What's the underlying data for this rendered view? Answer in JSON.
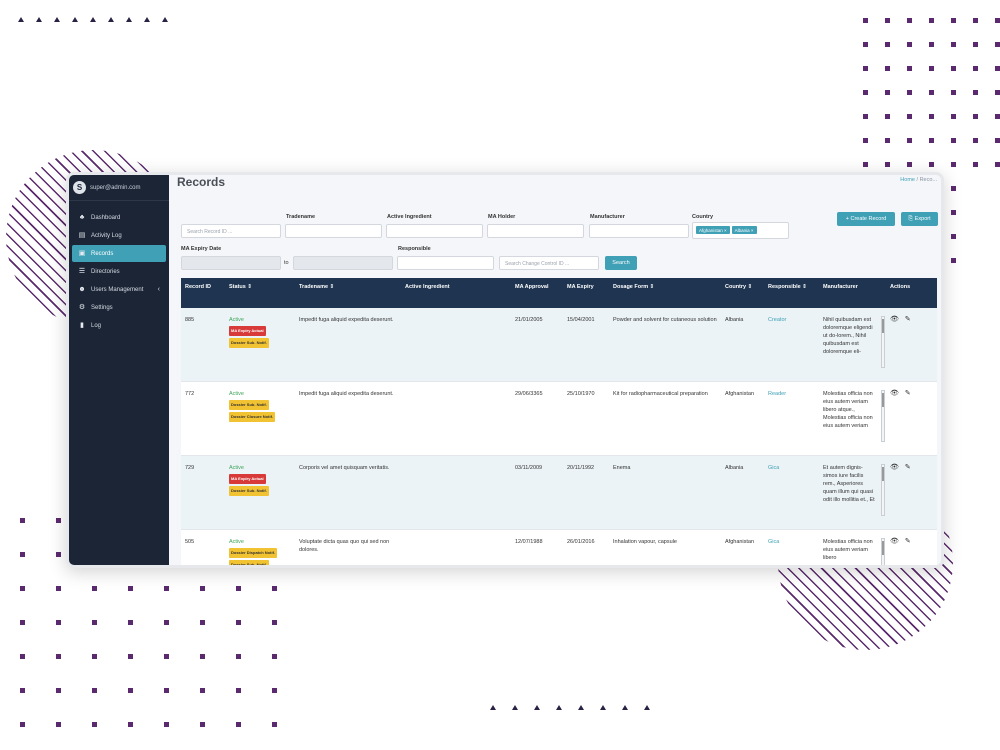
{
  "colors": {
    "accent": "#3fa0b6",
    "sidebar": "#1b2535",
    "table_header": "#1e3450",
    "status_active": "#3ea55a",
    "badge_red": "#d83a3a",
    "badge_yellow": "#f1c232",
    "decor_purple": "#5b2a6e"
  },
  "sidebar": {
    "avatar_letter": "S",
    "user_email": "super@admin.com",
    "items": [
      {
        "label": "Dashboard",
        "icon": "dashboard-icon",
        "glyph": "♣",
        "active": false
      },
      {
        "label": "Activity Log",
        "icon": "activity-log-icon",
        "glyph": "▤",
        "active": false
      },
      {
        "label": "Records",
        "icon": "records-icon",
        "glyph": "▣",
        "active": true
      },
      {
        "label": "Directories",
        "icon": "directories-icon",
        "glyph": "☰",
        "active": false
      },
      {
        "label": "Users Management",
        "icon": "users-icon",
        "glyph": "☻",
        "active": false,
        "caret": "‹"
      },
      {
        "label": "Settings",
        "icon": "settings-icon",
        "glyph": "⚙",
        "active": false
      },
      {
        "label": "Log",
        "icon": "log-icon",
        "glyph": "▮",
        "active": false
      }
    ]
  },
  "header": {
    "title": "Records",
    "breadcrumb_home": "Home",
    "breadcrumb_sep": " / ",
    "breadcrumb_current": "Reco..."
  },
  "filters": {
    "record_id_placeholder": "Search Record ID ...",
    "tradename_label": "Tradename",
    "active_ingredient_label": "Active Ingredient",
    "ma_holder_label": "MA Holder",
    "manufacturer_label": "Manufacturer",
    "country_label": "Country",
    "country_chips": [
      "Afghanistan ×",
      "Albania ×"
    ],
    "ma_expiry_label": "MA Expiry Date",
    "to_label": "to",
    "responsible_label": "Responsible",
    "change_control_placeholder": "Search Change Control ID ...",
    "search_button": "Search",
    "create_button": "+ Create Record",
    "export_button": "Export",
    "export_icon": "export-icon"
  },
  "table": {
    "headers": [
      "Record ID",
      "Status ⇕",
      "Tradename ⇕",
      "Active Ingredient",
      "MA Approval",
      "MA Expiry",
      "Dosage Form ⇕",
      "Country ⇕",
      "Responsible ⇕",
      "Manufacturer",
      "Actions"
    ],
    "sort_glyph": "⇕",
    "rows": [
      {
        "id": "885",
        "status": "Active",
        "badges": [
          {
            "text": "MA Expiry Actual",
            "color": "red"
          },
          {
            "text": "Dossier Sub. Notif.",
            "color": "yellow"
          }
        ],
        "tradename": "Impedit fuga aliquid expedita deserunt.",
        "active_ingredient": "",
        "ma_approval": "21/01/2005",
        "ma_expiry": "15/04/2001",
        "dosage_form": "Powder and solvent for cutaneous solution",
        "country": "Albania",
        "responsible": "Creator",
        "manufacturer": "Nihil quibusdam est doloremque eligendi ut do-lorem., Nihil quibusdam est doloremque eli-"
      },
      {
        "id": "772",
        "status": "Active",
        "badges": [
          {
            "text": "Dossier Sub. Notif.",
            "color": "yellow"
          },
          {
            "text": "Dossier Closure Notif.",
            "color": "yellow"
          }
        ],
        "tradename": "Impedit fuga aliquid expedita deserunt.",
        "active_ingredient": "",
        "ma_approval": "29/06/3365",
        "ma_expiry": "25/10/1970",
        "dosage_form": "Kit for radiopharmaceutical preparation",
        "country": "Afghanistan",
        "responsible": "Reader",
        "manufacturer": "Molestias officia non eius autem veriam libero atque., Molestias officia non eius autem veriam"
      },
      {
        "id": "729",
        "status": "Active",
        "badges": [
          {
            "text": "MA Expiry Actual",
            "color": "red"
          },
          {
            "text": "Dossier Sub. Notif.",
            "color": "yellow"
          }
        ],
        "tradename": "Corporis vel amet quisquam veritatis.",
        "active_ingredient": "",
        "ma_approval": "03/11/2009",
        "ma_expiry": "20/11/1992",
        "dosage_form": "Enema",
        "country": "Albania",
        "responsible": "Gica",
        "manufacturer": "Et autem dignis-simos iure facilis rem., Asperiores quam illum qui quasi odit illo mollitia et., Et"
      },
      {
        "id": "505",
        "status": "Active",
        "badges": [
          {
            "text": "Dossier Dispatch Notif.",
            "color": "yellow"
          },
          {
            "text": "Dossier Sub. Notif.",
            "color": "yellow"
          }
        ],
        "tradename": "Voluptate dicta quas quo qui sed non dolores.",
        "active_ingredient": "",
        "ma_approval": "12/07/1988",
        "ma_expiry": "26/01/2016",
        "dosage_form": "Inhalation vapour, capsule",
        "country": "Afghanistan",
        "responsible": "Gica",
        "manufacturer": "Molestias officia non eius autem veriam libero"
      }
    ],
    "action_view_glyph": "👁",
    "action_edit_glyph": "✎"
  }
}
